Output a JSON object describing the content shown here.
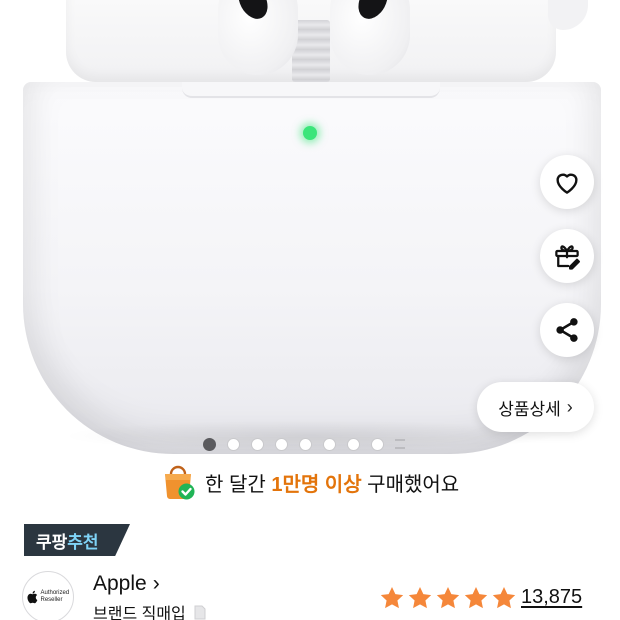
{
  "product_image": {
    "carousel": {
      "total": 8,
      "active_index": 0
    }
  },
  "actions": {
    "like_icon": "heart-icon",
    "gift_icon": "gift-icon",
    "share_icon": "share-icon",
    "details_label": "상품상세"
  },
  "purchase_info": {
    "prefix": "한 달간 ",
    "highlight": "1만명 이상",
    "suffix": " 구매했어요",
    "highlight_color": "#e3740b"
  },
  "badge": {
    "part1": "쿠팡",
    "part2": "추천"
  },
  "seller": {
    "logo_text": "Authorized Reseller",
    "brand_name": "Apple",
    "subtitle": "브랜드 직매입"
  },
  "rating": {
    "stars": 5,
    "max": 5,
    "count": "13,875",
    "star_color": "#f5873a"
  }
}
